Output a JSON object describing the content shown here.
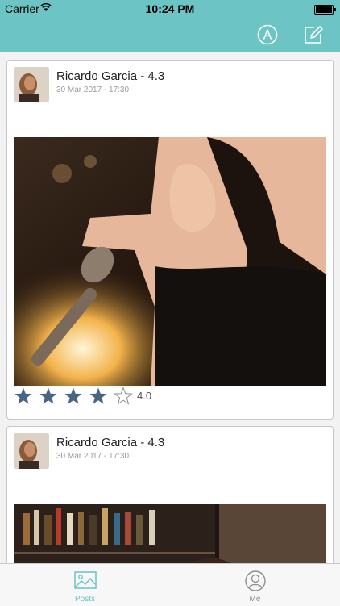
{
  "status_bar": {
    "carrier": "Carrier",
    "time": "10:24 PM"
  },
  "nav": {
    "icons": [
      "a-icon",
      "compose-icon"
    ]
  },
  "colors": {
    "accent": "#6cc4c4",
    "star": "#4a6583",
    "border": "#c7c7c7"
  },
  "posts": [
    {
      "author": "Ricardo Garcia - 4.3",
      "timestamp": "30 Mar 2017 - 17:30",
      "rating_value": "4.0",
      "stars": 4,
      "max_stars": 5
    },
    {
      "author": "Ricardo Garcia - 4.3",
      "timestamp": "30 Mar 2017 - 17:30"
    }
  ],
  "tabs": [
    {
      "label": "Posts",
      "icon": "image-icon",
      "selected": true
    },
    {
      "label": "Me",
      "icon": "user-icon",
      "selected": false
    }
  ]
}
